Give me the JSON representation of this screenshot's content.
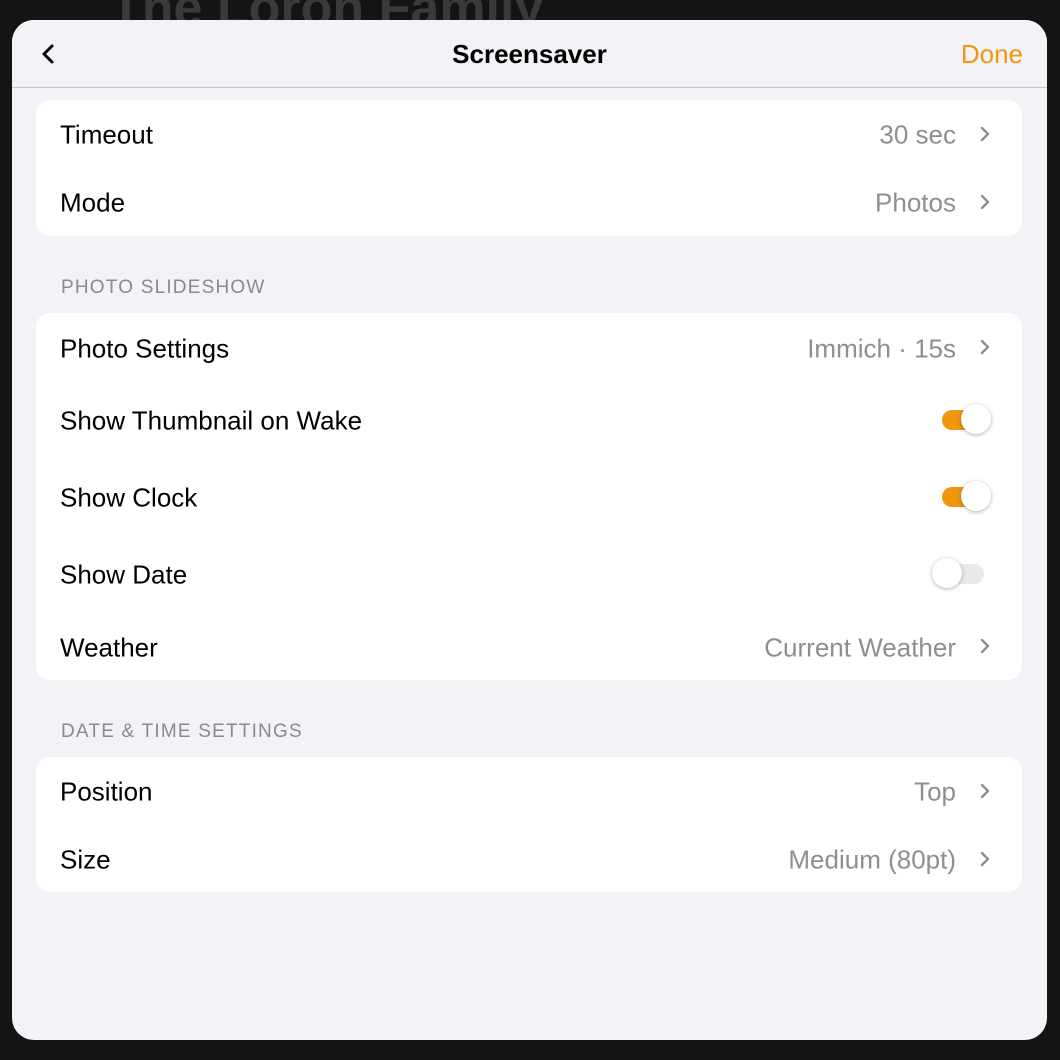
{
  "background": {
    "title": "The Loron Family"
  },
  "nav": {
    "title": "Screensaver",
    "done_label": "Done"
  },
  "general": {
    "rows": [
      {
        "label": "Timeout",
        "value": "30 sec"
      },
      {
        "label": "Mode",
        "value": "Photos"
      }
    ]
  },
  "photo_slideshow": {
    "header": "PHOTO SLIDESHOW",
    "photo_settings": {
      "label": "Photo Settings",
      "value": "Immich · 15s"
    },
    "show_thumbnail": {
      "label": "Show Thumbnail on Wake",
      "on": true
    },
    "show_clock": {
      "label": "Show Clock",
      "on": true
    },
    "show_date": {
      "label": "Show Date",
      "on": false
    },
    "weather": {
      "label": "Weather",
      "value": "Current Weather"
    }
  },
  "date_time": {
    "header": "DATE & TIME SETTINGS",
    "rows": [
      {
        "label": "Position",
        "value": "Top"
      },
      {
        "label": "Size",
        "value": "Medium (80pt)"
      }
    ]
  },
  "colors": {
    "accent": "#f0960f",
    "secondary_text": "#8e8e93",
    "background": "#f2f2f7",
    "toggle_off": "#e9e9ea"
  },
  "icons": [
    "chevron-left-icon",
    "chevron-right-icon"
  ]
}
